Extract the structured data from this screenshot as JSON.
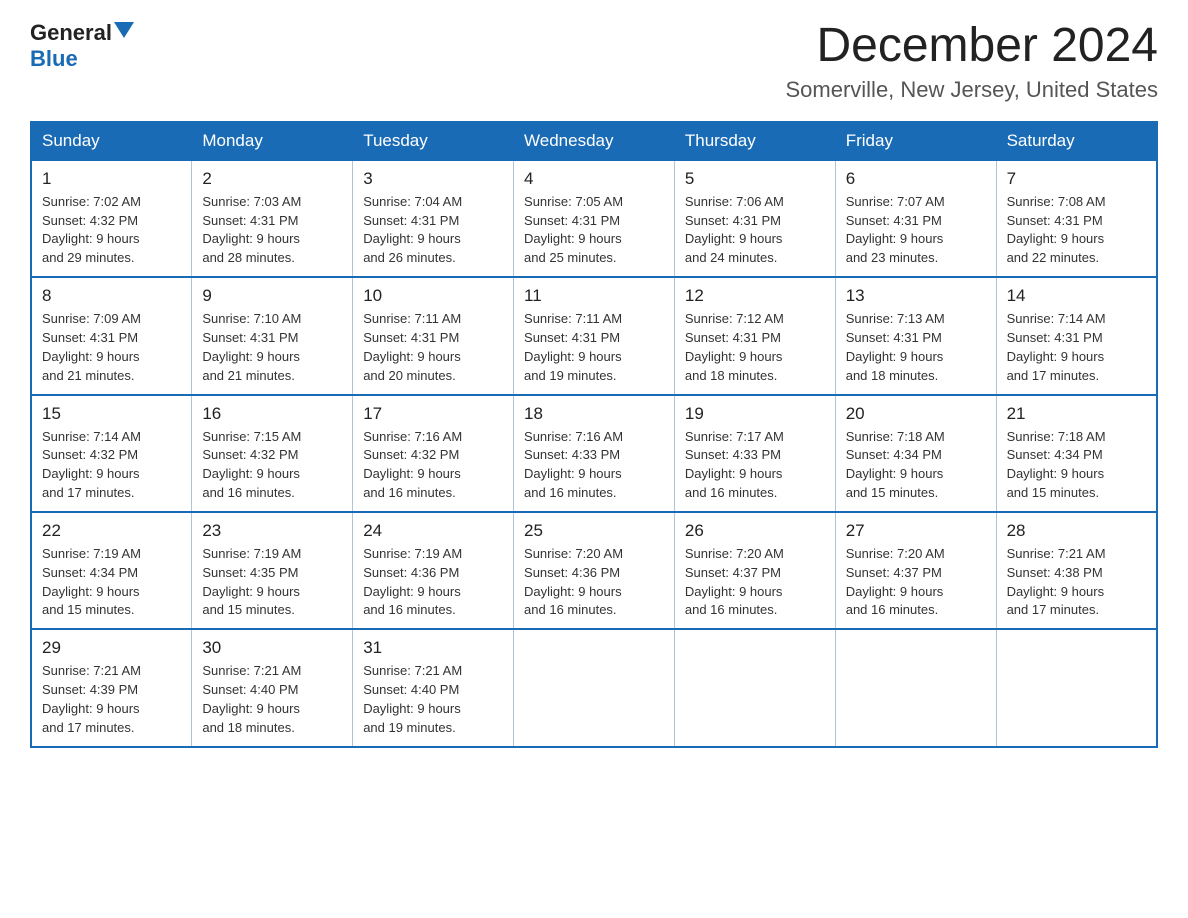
{
  "header": {
    "logo_general": "General",
    "logo_blue": "Blue",
    "month_title": "December 2024",
    "location": "Somerville, New Jersey, United States"
  },
  "days_of_week": [
    "Sunday",
    "Monday",
    "Tuesday",
    "Wednesday",
    "Thursday",
    "Friday",
    "Saturday"
  ],
  "weeks": [
    [
      {
        "day": "1",
        "sunrise": "7:02 AM",
        "sunset": "4:32 PM",
        "daylight": "9 hours and 29 minutes."
      },
      {
        "day": "2",
        "sunrise": "7:03 AM",
        "sunset": "4:31 PM",
        "daylight": "9 hours and 28 minutes."
      },
      {
        "day": "3",
        "sunrise": "7:04 AM",
        "sunset": "4:31 PM",
        "daylight": "9 hours and 26 minutes."
      },
      {
        "day": "4",
        "sunrise": "7:05 AM",
        "sunset": "4:31 PM",
        "daylight": "9 hours and 25 minutes."
      },
      {
        "day": "5",
        "sunrise": "7:06 AM",
        "sunset": "4:31 PM",
        "daylight": "9 hours and 24 minutes."
      },
      {
        "day": "6",
        "sunrise": "7:07 AM",
        "sunset": "4:31 PM",
        "daylight": "9 hours and 23 minutes."
      },
      {
        "day": "7",
        "sunrise": "7:08 AM",
        "sunset": "4:31 PM",
        "daylight": "9 hours and 22 minutes."
      }
    ],
    [
      {
        "day": "8",
        "sunrise": "7:09 AM",
        "sunset": "4:31 PM",
        "daylight": "9 hours and 21 minutes."
      },
      {
        "day": "9",
        "sunrise": "7:10 AM",
        "sunset": "4:31 PM",
        "daylight": "9 hours and 21 minutes."
      },
      {
        "day": "10",
        "sunrise": "7:11 AM",
        "sunset": "4:31 PM",
        "daylight": "9 hours and 20 minutes."
      },
      {
        "day": "11",
        "sunrise": "7:11 AM",
        "sunset": "4:31 PM",
        "daylight": "9 hours and 19 minutes."
      },
      {
        "day": "12",
        "sunrise": "7:12 AM",
        "sunset": "4:31 PM",
        "daylight": "9 hours and 18 minutes."
      },
      {
        "day": "13",
        "sunrise": "7:13 AM",
        "sunset": "4:31 PM",
        "daylight": "9 hours and 18 minutes."
      },
      {
        "day": "14",
        "sunrise": "7:14 AM",
        "sunset": "4:31 PM",
        "daylight": "9 hours and 17 minutes."
      }
    ],
    [
      {
        "day": "15",
        "sunrise": "7:14 AM",
        "sunset": "4:32 PM",
        "daylight": "9 hours and 17 minutes."
      },
      {
        "day": "16",
        "sunrise": "7:15 AM",
        "sunset": "4:32 PM",
        "daylight": "9 hours and 16 minutes."
      },
      {
        "day": "17",
        "sunrise": "7:16 AM",
        "sunset": "4:32 PM",
        "daylight": "9 hours and 16 minutes."
      },
      {
        "day": "18",
        "sunrise": "7:16 AM",
        "sunset": "4:33 PM",
        "daylight": "9 hours and 16 minutes."
      },
      {
        "day": "19",
        "sunrise": "7:17 AM",
        "sunset": "4:33 PM",
        "daylight": "9 hours and 16 minutes."
      },
      {
        "day": "20",
        "sunrise": "7:18 AM",
        "sunset": "4:34 PM",
        "daylight": "9 hours and 15 minutes."
      },
      {
        "day": "21",
        "sunrise": "7:18 AM",
        "sunset": "4:34 PM",
        "daylight": "9 hours and 15 minutes."
      }
    ],
    [
      {
        "day": "22",
        "sunrise": "7:19 AM",
        "sunset": "4:34 PM",
        "daylight": "9 hours and 15 minutes."
      },
      {
        "day": "23",
        "sunrise": "7:19 AM",
        "sunset": "4:35 PM",
        "daylight": "9 hours and 15 minutes."
      },
      {
        "day": "24",
        "sunrise": "7:19 AM",
        "sunset": "4:36 PM",
        "daylight": "9 hours and 16 minutes."
      },
      {
        "day": "25",
        "sunrise": "7:20 AM",
        "sunset": "4:36 PM",
        "daylight": "9 hours and 16 minutes."
      },
      {
        "day": "26",
        "sunrise": "7:20 AM",
        "sunset": "4:37 PM",
        "daylight": "9 hours and 16 minutes."
      },
      {
        "day": "27",
        "sunrise": "7:20 AM",
        "sunset": "4:37 PM",
        "daylight": "9 hours and 16 minutes."
      },
      {
        "day": "28",
        "sunrise": "7:21 AM",
        "sunset": "4:38 PM",
        "daylight": "9 hours and 17 minutes."
      }
    ],
    [
      {
        "day": "29",
        "sunrise": "7:21 AM",
        "sunset": "4:39 PM",
        "daylight": "9 hours and 17 minutes."
      },
      {
        "day": "30",
        "sunrise": "7:21 AM",
        "sunset": "4:40 PM",
        "daylight": "9 hours and 18 minutes."
      },
      {
        "day": "31",
        "sunrise": "7:21 AM",
        "sunset": "4:40 PM",
        "daylight": "9 hours and 19 minutes."
      },
      null,
      null,
      null,
      null
    ]
  ],
  "labels": {
    "sunrise": "Sunrise:",
    "sunset": "Sunset:",
    "daylight": "Daylight:"
  }
}
